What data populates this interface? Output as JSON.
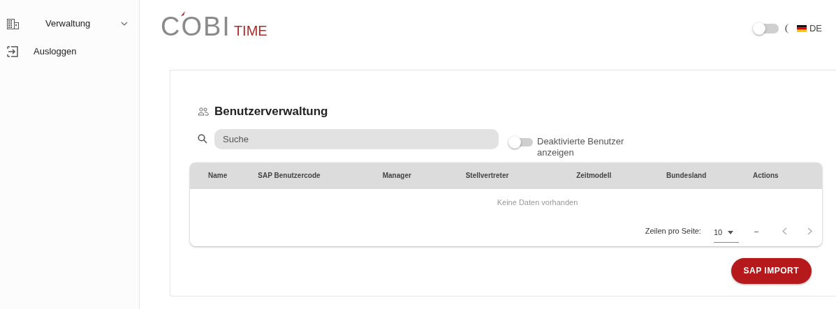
{
  "sidebar": {
    "items": [
      {
        "kind": "group",
        "label": "Verwaltung",
        "expanded": false
      },
      {
        "kind": "link",
        "label": "Ausloggen"
      }
    ]
  },
  "header": {
    "logo": {
      "main": "COBI",
      "sub": "TIME"
    },
    "dark_mode": {
      "on": false
    },
    "language": "DE"
  },
  "page": {
    "title": "Benutzerverwaltung",
    "search": {
      "placeholder": "Suche"
    },
    "show_disabled": {
      "label": "Deaktivierte Benutzer anzeigen",
      "checked": false
    },
    "table": {
      "columns": [
        "Name",
        "SAP Benutzercode",
        "Manager",
        "Stellvertreter",
        "Zeitmodell",
        "Bundesland",
        "Actions"
      ],
      "empty_text": "Keine Daten vorhanden",
      "pagination": {
        "rows_label": "Zeilen pro Seite:",
        "rows_per_page": "10",
        "range": "–"
      }
    },
    "button": "SAP IMPORT"
  }
}
